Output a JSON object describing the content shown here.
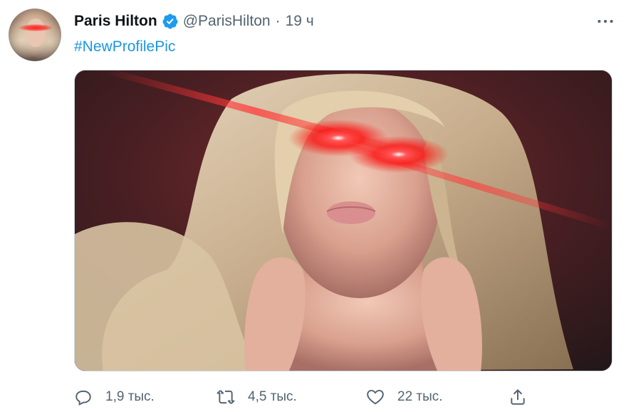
{
  "author": {
    "name": "Paris Hilton",
    "handle": "@ParisHilton",
    "separator": "·",
    "time": "19 ч",
    "verified": true
  },
  "tweet": {
    "text": "#NewProfilePic"
  },
  "media": {
    "icon": "photo"
  },
  "actions": {
    "reply_count": "1,9 тыс.",
    "retweet_count": "4,5 тыс.",
    "like_count": "22 тыс."
  },
  "colors": {
    "accent": "#1b95e0",
    "secondary_text": "#536471",
    "verified_badge": "#1d9bf0"
  }
}
